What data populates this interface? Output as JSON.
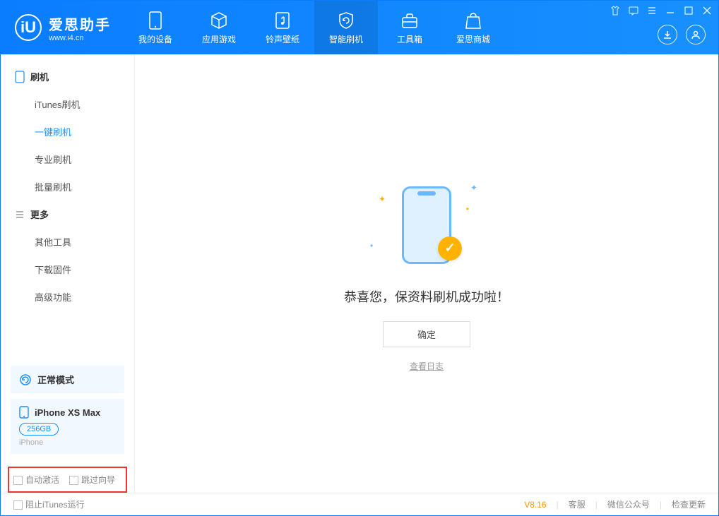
{
  "app": {
    "logo_letter": "iU",
    "title": "爱思助手",
    "subtitle": "www.i4.cn"
  },
  "nav": {
    "items": [
      {
        "label": "我的设备"
      },
      {
        "label": "应用游戏"
      },
      {
        "label": "铃声壁纸"
      },
      {
        "label": "智能刷机"
      },
      {
        "label": "工具箱"
      },
      {
        "label": "爱思商城"
      }
    ]
  },
  "sidebar": {
    "group1": {
      "title": "刷机",
      "items": [
        "iTunes刷机",
        "一键刷机",
        "专业刷机",
        "批量刷机"
      ],
      "active_index": 1
    },
    "group2": {
      "title": "更多",
      "items": [
        "其他工具",
        "下载固件",
        "高级功能"
      ]
    },
    "mode": {
      "label": "正常模式"
    },
    "device": {
      "name": "iPhone XS Max",
      "storage": "256GB",
      "type": "iPhone"
    },
    "checks": {
      "auto_activate": "自动激活",
      "skip_guide": "跳过向导"
    }
  },
  "main": {
    "success_text": "恭喜您，保资料刷机成功啦！",
    "ok_label": "确定",
    "log_link": "查看日志"
  },
  "footer": {
    "block_itunes": "阻止iTunes运行",
    "version": "V8.16",
    "links": [
      "客服",
      "微信公众号",
      "检查更新"
    ]
  }
}
